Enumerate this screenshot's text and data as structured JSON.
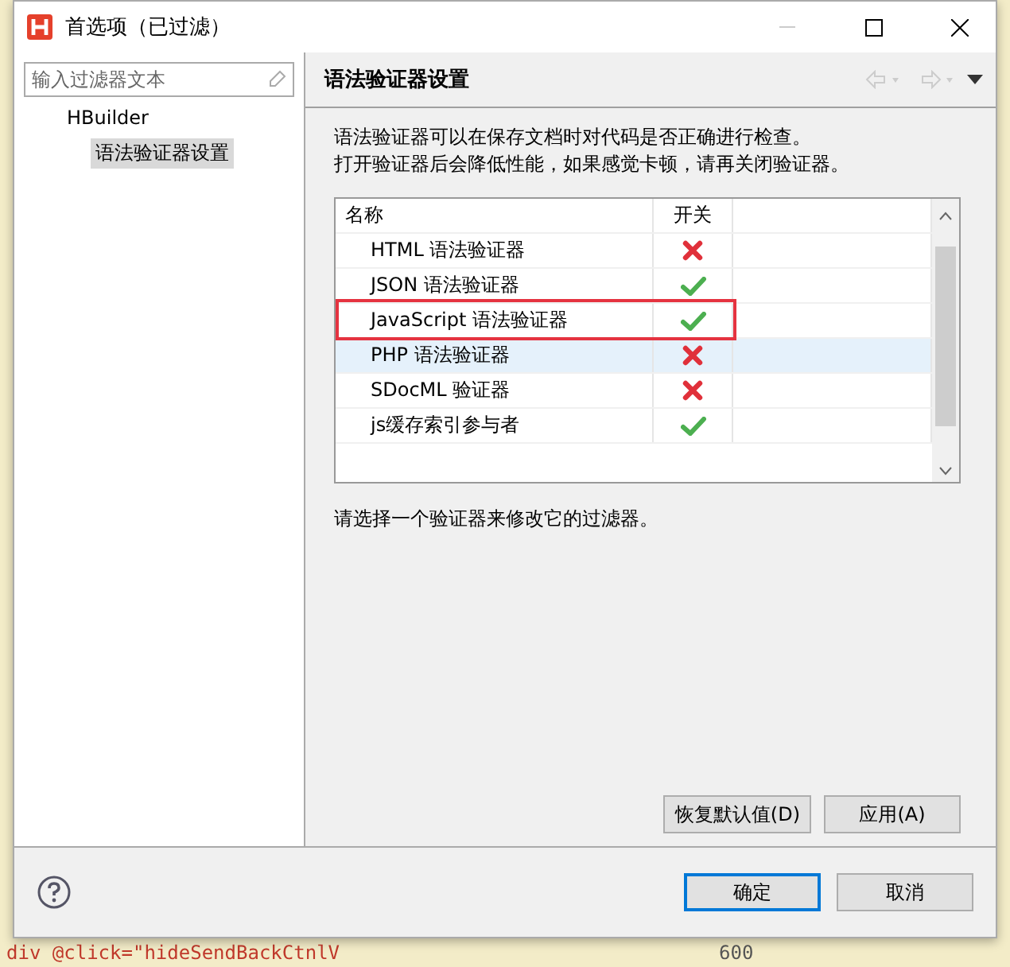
{
  "window": {
    "title": "首选项（已过滤）"
  },
  "filter": {
    "placeholder": "输入过滤器文本"
  },
  "tree": [
    {
      "label": "HBuilder",
      "selected": false,
      "children": [
        {
          "label": "语法验证器设置",
          "selected": true
        }
      ]
    }
  ],
  "page": {
    "title": "语法验证器设置",
    "description": [
      "语法验证器可以在保存文档时对代码是否正确进行检查。",
      "打开验证器后会降低性能，如果感觉卡顿，请再关闭验证器。"
    ],
    "table": {
      "columns": [
        "名称",
        "开关"
      ],
      "rows": [
        {
          "name": "HTML 语法验证器",
          "on": false,
          "selected": false,
          "highlighted": false
        },
        {
          "name": "JSON 语法验证器",
          "on": true,
          "selected": false,
          "highlighted": false
        },
        {
          "name": "JavaScript 语法验证器",
          "on": true,
          "selected": false,
          "highlighted": true
        },
        {
          "name": "PHP 语法验证器",
          "on": false,
          "selected": true,
          "highlighted": false
        },
        {
          "name": "SDocML 验证器",
          "on": false,
          "selected": false,
          "highlighted": false
        },
        {
          "name": "js缓存索引参与者",
          "on": true,
          "selected": false,
          "highlighted": false
        }
      ]
    },
    "hint": "请选择一个验证器来修改它的过滤器。",
    "buttons": [
      "恢复默认值(D)",
      "应用(A)"
    ]
  },
  "footer": {
    "buttons": [
      {
        "label": "确定",
        "default": true
      },
      {
        "label": "取消",
        "default": false
      }
    ]
  },
  "backdrop": {
    "code": "div @click=\"hideSendBackCtnlV",
    "line": "600"
  }
}
